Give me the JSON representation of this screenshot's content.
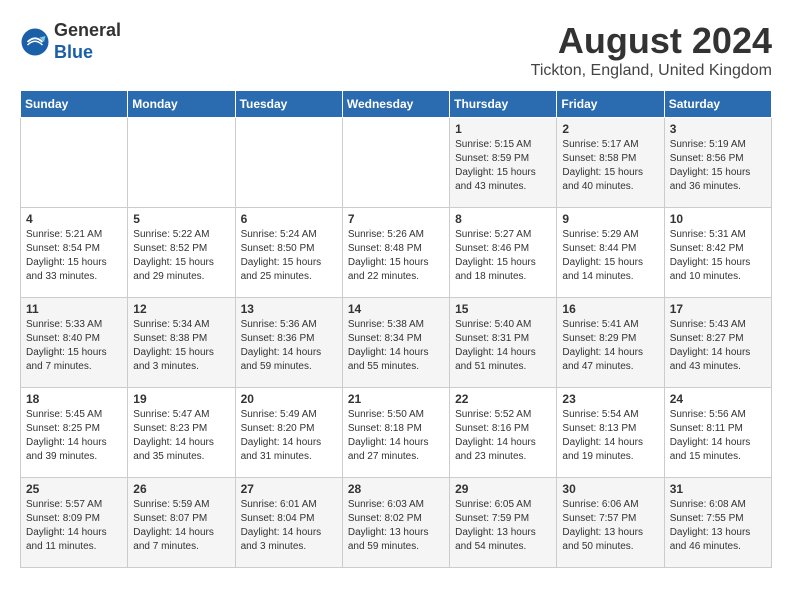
{
  "header": {
    "logo_general": "General",
    "logo_blue": "Blue",
    "month_year": "August 2024",
    "location": "Tickton, England, United Kingdom"
  },
  "weekdays": [
    "Sunday",
    "Monday",
    "Tuesday",
    "Wednesday",
    "Thursday",
    "Friday",
    "Saturday"
  ],
  "weeks": [
    [
      {
        "day": "",
        "sunrise": "",
        "sunset": "",
        "daylight": ""
      },
      {
        "day": "",
        "sunrise": "",
        "sunset": "",
        "daylight": ""
      },
      {
        "day": "",
        "sunrise": "",
        "sunset": "",
        "daylight": ""
      },
      {
        "day": "",
        "sunrise": "",
        "sunset": "",
        "daylight": ""
      },
      {
        "day": "1",
        "sunrise": "Sunrise: 5:15 AM",
        "sunset": "Sunset: 8:59 PM",
        "daylight": "Daylight: 15 hours and 43 minutes."
      },
      {
        "day": "2",
        "sunrise": "Sunrise: 5:17 AM",
        "sunset": "Sunset: 8:58 PM",
        "daylight": "Daylight: 15 hours and 40 minutes."
      },
      {
        "day": "3",
        "sunrise": "Sunrise: 5:19 AM",
        "sunset": "Sunset: 8:56 PM",
        "daylight": "Daylight: 15 hours and 36 minutes."
      }
    ],
    [
      {
        "day": "4",
        "sunrise": "Sunrise: 5:21 AM",
        "sunset": "Sunset: 8:54 PM",
        "daylight": "Daylight: 15 hours and 33 minutes."
      },
      {
        "day": "5",
        "sunrise": "Sunrise: 5:22 AM",
        "sunset": "Sunset: 8:52 PM",
        "daylight": "Daylight: 15 hours and 29 minutes."
      },
      {
        "day": "6",
        "sunrise": "Sunrise: 5:24 AM",
        "sunset": "Sunset: 8:50 PM",
        "daylight": "Daylight: 15 hours and 25 minutes."
      },
      {
        "day": "7",
        "sunrise": "Sunrise: 5:26 AM",
        "sunset": "Sunset: 8:48 PM",
        "daylight": "Daylight: 15 hours and 22 minutes."
      },
      {
        "day": "8",
        "sunrise": "Sunrise: 5:27 AM",
        "sunset": "Sunset: 8:46 PM",
        "daylight": "Daylight: 15 hours and 18 minutes."
      },
      {
        "day": "9",
        "sunrise": "Sunrise: 5:29 AM",
        "sunset": "Sunset: 8:44 PM",
        "daylight": "Daylight: 15 hours and 14 minutes."
      },
      {
        "day": "10",
        "sunrise": "Sunrise: 5:31 AM",
        "sunset": "Sunset: 8:42 PM",
        "daylight": "Daylight: 15 hours and 10 minutes."
      }
    ],
    [
      {
        "day": "11",
        "sunrise": "Sunrise: 5:33 AM",
        "sunset": "Sunset: 8:40 PM",
        "daylight": "Daylight: 15 hours and 7 minutes."
      },
      {
        "day": "12",
        "sunrise": "Sunrise: 5:34 AM",
        "sunset": "Sunset: 8:38 PM",
        "daylight": "Daylight: 15 hours and 3 minutes."
      },
      {
        "day": "13",
        "sunrise": "Sunrise: 5:36 AM",
        "sunset": "Sunset: 8:36 PM",
        "daylight": "Daylight: 14 hours and 59 minutes."
      },
      {
        "day": "14",
        "sunrise": "Sunrise: 5:38 AM",
        "sunset": "Sunset: 8:34 PM",
        "daylight": "Daylight: 14 hours and 55 minutes."
      },
      {
        "day": "15",
        "sunrise": "Sunrise: 5:40 AM",
        "sunset": "Sunset: 8:31 PM",
        "daylight": "Daylight: 14 hours and 51 minutes."
      },
      {
        "day": "16",
        "sunrise": "Sunrise: 5:41 AM",
        "sunset": "Sunset: 8:29 PM",
        "daylight": "Daylight: 14 hours and 47 minutes."
      },
      {
        "day": "17",
        "sunrise": "Sunrise: 5:43 AM",
        "sunset": "Sunset: 8:27 PM",
        "daylight": "Daylight: 14 hours and 43 minutes."
      }
    ],
    [
      {
        "day": "18",
        "sunrise": "Sunrise: 5:45 AM",
        "sunset": "Sunset: 8:25 PM",
        "daylight": "Daylight: 14 hours and 39 minutes."
      },
      {
        "day": "19",
        "sunrise": "Sunrise: 5:47 AM",
        "sunset": "Sunset: 8:23 PM",
        "daylight": "Daylight: 14 hours and 35 minutes."
      },
      {
        "day": "20",
        "sunrise": "Sunrise: 5:49 AM",
        "sunset": "Sunset: 8:20 PM",
        "daylight": "Daylight: 14 hours and 31 minutes."
      },
      {
        "day": "21",
        "sunrise": "Sunrise: 5:50 AM",
        "sunset": "Sunset: 8:18 PM",
        "daylight": "Daylight: 14 hours and 27 minutes."
      },
      {
        "day": "22",
        "sunrise": "Sunrise: 5:52 AM",
        "sunset": "Sunset: 8:16 PM",
        "daylight": "Daylight: 14 hours and 23 minutes."
      },
      {
        "day": "23",
        "sunrise": "Sunrise: 5:54 AM",
        "sunset": "Sunset: 8:13 PM",
        "daylight": "Daylight: 14 hours and 19 minutes."
      },
      {
        "day": "24",
        "sunrise": "Sunrise: 5:56 AM",
        "sunset": "Sunset: 8:11 PM",
        "daylight": "Daylight: 14 hours and 15 minutes."
      }
    ],
    [
      {
        "day": "25",
        "sunrise": "Sunrise: 5:57 AM",
        "sunset": "Sunset: 8:09 PM",
        "daylight": "Daylight: 14 hours and 11 minutes."
      },
      {
        "day": "26",
        "sunrise": "Sunrise: 5:59 AM",
        "sunset": "Sunset: 8:07 PM",
        "daylight": "Daylight: 14 hours and 7 minutes."
      },
      {
        "day": "27",
        "sunrise": "Sunrise: 6:01 AM",
        "sunset": "Sunset: 8:04 PM",
        "daylight": "Daylight: 14 hours and 3 minutes."
      },
      {
        "day": "28",
        "sunrise": "Sunrise: 6:03 AM",
        "sunset": "Sunset: 8:02 PM",
        "daylight": "Daylight: 13 hours and 59 minutes."
      },
      {
        "day": "29",
        "sunrise": "Sunrise: 6:05 AM",
        "sunset": "Sunset: 7:59 PM",
        "daylight": "Daylight: 13 hours and 54 minutes."
      },
      {
        "day": "30",
        "sunrise": "Sunrise: 6:06 AM",
        "sunset": "Sunset: 7:57 PM",
        "daylight": "Daylight: 13 hours and 50 minutes."
      },
      {
        "day": "31",
        "sunrise": "Sunrise: 6:08 AM",
        "sunset": "Sunset: 7:55 PM",
        "daylight": "Daylight: 13 hours and 46 minutes."
      }
    ]
  ]
}
